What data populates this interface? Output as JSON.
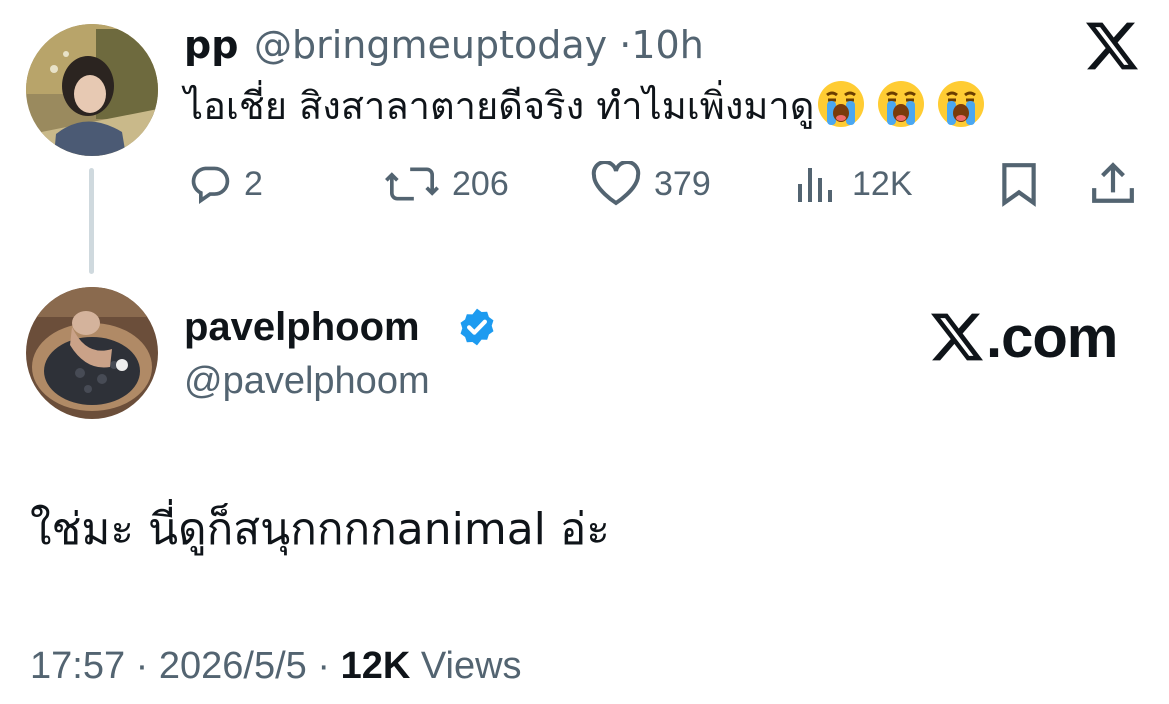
{
  "reply_to": {
    "display_name": "pp",
    "handle": "@bringmeuptoday",
    "separator": "·",
    "time": "10h",
    "text": "ไอเชี่ย สิงสาลาตายดีจริง ทำไมเพิ่งมาดู",
    "emojis": [
      "loudly-crying-face",
      "loudly-crying-face",
      "loudly-crying-face"
    ],
    "actions": {
      "replies": "2",
      "reposts": "206",
      "likes": "379",
      "views": "12K"
    }
  },
  "main_tweet": {
    "display_name": "pavelphoom",
    "verified": true,
    "handle": "@pavelphoom",
    "text": "ใช่มะ นี่ดูก็สนุกกกกanimal อ่ะ",
    "time": "17:57",
    "date": "2026/5/5",
    "dot": "·",
    "views_count": "12K",
    "views_label": "Views"
  },
  "brand": {
    "site_label": ".com"
  },
  "colors": {
    "text_primary": "#0f1419",
    "text_secondary": "#536471",
    "verified_blue": "#1d9bf0",
    "thread_line": "#cfd9de"
  }
}
